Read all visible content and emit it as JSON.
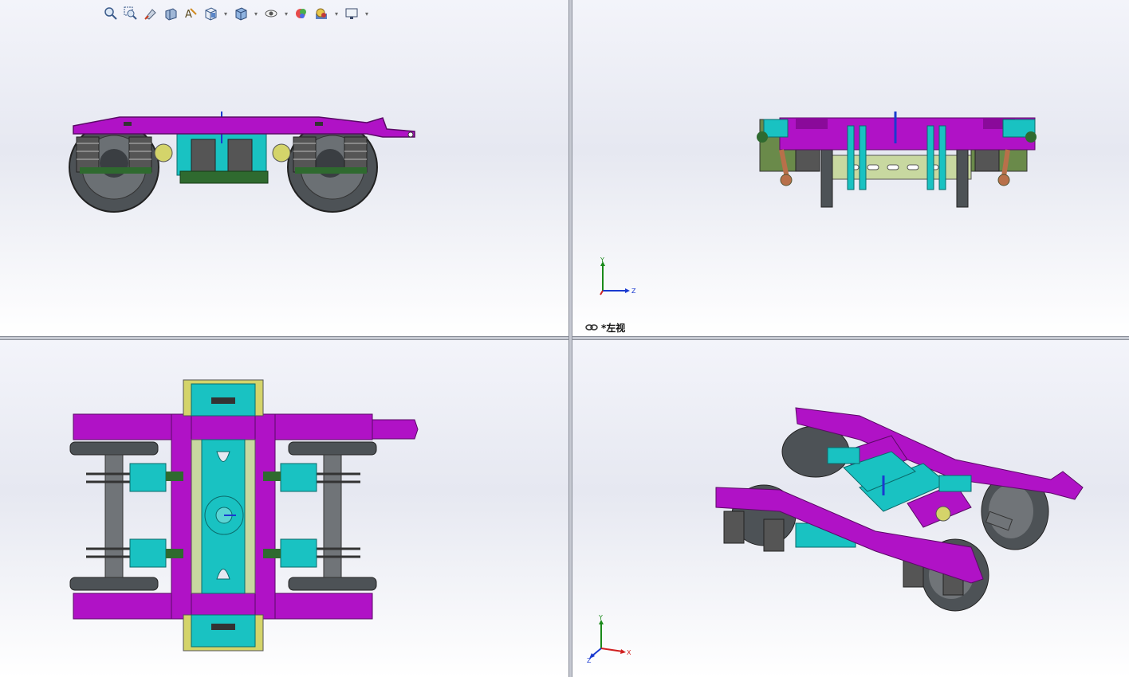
{
  "viewports": {
    "top_left": {
      "label": ""
    },
    "top_right": {
      "label": "*左视"
    },
    "bottom_left": {
      "label": ""
    },
    "bottom_right": {
      "label": ""
    }
  },
  "toolbar": {
    "icons": [
      "zoom-to-fit-icon",
      "zoom-area-icon",
      "previous-view-icon",
      "section-view-icon",
      "dynamic-annotation-icon",
      "view-orientation-icon",
      "display-style-icon",
      "hide-show-items-icon",
      "edit-appearance-icon",
      "apply-scene-icon",
      "view-settings-icon"
    ]
  },
  "triads": {
    "top_right": {
      "up": "Y",
      "right": "Z"
    },
    "bottom_right": {
      "up": "Y",
      "right": "X",
      "diag": "Z"
    }
  },
  "colors": {
    "frame": "#b012c6",
    "parts": "#19c2c2",
    "wheel": "#555a5e",
    "spring": "#2f6a2f",
    "axle": "#707478",
    "bracket": "#d4d46a"
  }
}
